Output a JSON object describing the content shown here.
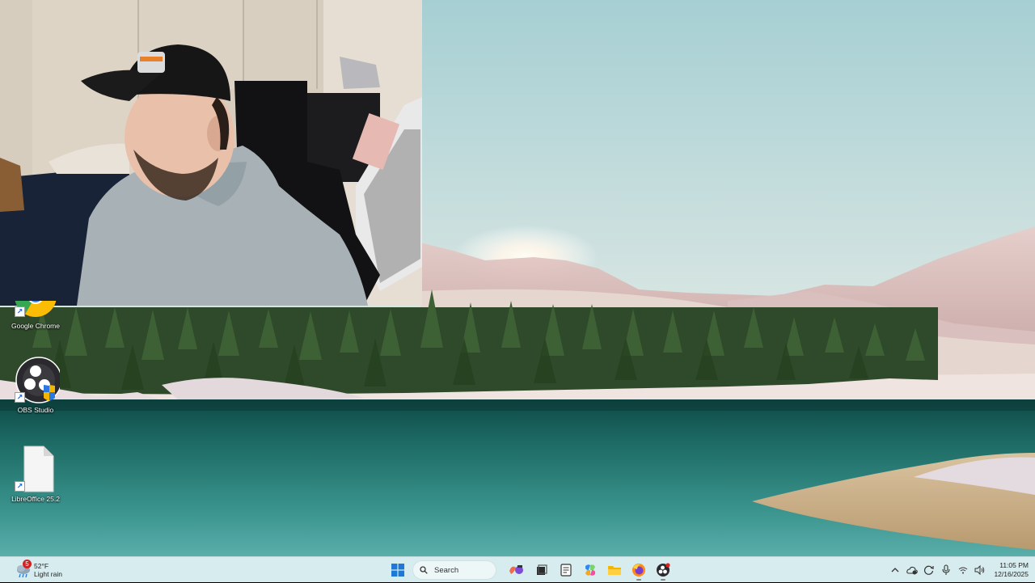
{
  "desktop": {
    "icons": [
      {
        "label": "Google Chrome",
        "icon": "google-chrome-icon"
      },
      {
        "label": "OBS Studio",
        "icon": "obs-studio-icon"
      },
      {
        "label": "LibreOffice 25.2",
        "icon": "libreoffice-icon"
      }
    ]
  },
  "taskbar": {
    "weather": {
      "temp": "52°F",
      "condition": "Light rain",
      "badge": "5"
    },
    "search_placeholder": "Search",
    "pinned": [
      "start-icon",
      "search-icon",
      "widgets-icon",
      "task-view-icon",
      "notepad-icon",
      "copilot-icon",
      "file-explorer-icon",
      "firefox-icon",
      "obs-studio-icon"
    ],
    "clock": {
      "time": "11:05 PM",
      "date": "12/16/2025"
    }
  },
  "colors": {
    "taskbar_bg": "#d7ecee",
    "badge": "#d42020"
  }
}
